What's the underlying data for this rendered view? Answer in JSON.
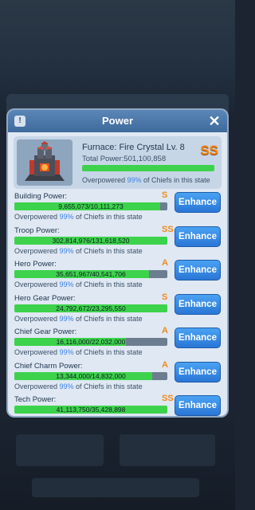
{
  "dialog": {
    "title": "Power",
    "info_label": "!",
    "close_label": "✕"
  },
  "furnace": {
    "name": "Furnace: Fire Crystal Lv. 8",
    "total_label": "Total Power:",
    "total_value": "501,100,858",
    "grade": "SS",
    "bar_fill_fraction": 1.0,
    "over_prefix": "Overpowered ",
    "over_percent": "99%",
    "over_suffix": " of Chiefs in this state"
  },
  "rows": [
    {
      "label": "Building Power:",
      "grade": "S",
      "value_text": "9,655,073/10,111,273",
      "fill_fraction": 0.955,
      "over_prefix": "Overpowered ",
      "over_percent": "99%",
      "over_suffix": " of Chiefs in this state",
      "button": "Enhance"
    },
    {
      "label": "Troop Power:",
      "grade": "SS",
      "value_text": "302,814,976/131,618,520",
      "fill_fraction": 1.0,
      "over_prefix": "Overpowered ",
      "over_percent": "99%",
      "over_suffix": " of Chiefs in this state",
      "button": "Enhance"
    },
    {
      "label": "Hero Power:",
      "grade": "A",
      "value_text": "35,651,967/40,541,706",
      "fill_fraction": 0.88,
      "over_prefix": "Overpowered ",
      "over_percent": "99%",
      "over_suffix": " of Chiefs in this state",
      "button": "Enhance"
    },
    {
      "label": "Hero Gear Power:",
      "grade": "S",
      "value_text": "24,792,672/23,295,550",
      "fill_fraction": 1.0,
      "over_prefix": "Overpowered ",
      "over_percent": "99%",
      "over_suffix": " of Chiefs in this state",
      "button": "Enhance"
    },
    {
      "label": "Chief Gear Power:",
      "grade": "A",
      "value_text": "16,116,000/22,032,000",
      "fill_fraction": 0.73,
      "over_prefix": "Overpowered ",
      "over_percent": "99%",
      "over_suffix": " of Chiefs in this state",
      "button": "Enhance"
    },
    {
      "label": "Chief Charm Power:",
      "grade": "A",
      "value_text": "13,344,000/14,832,000",
      "fill_fraction": 0.9,
      "over_prefix": "Overpowered ",
      "over_percent": "99%",
      "over_suffix": " of Chiefs in this state",
      "button": "Enhance"
    },
    {
      "label": "Tech Power:",
      "grade": "SS",
      "value_text": "41,113,750/35,428,898",
      "fill_fraction": 1.0,
      "over_prefix": "Overpowered ",
      "over_percent": "99%",
      "over_suffix": " of Chiefs in this state",
      "button": "Enhance"
    }
  ],
  "colors": {
    "accent_green": "#3dd24b",
    "grade_orange": "#f08a1c",
    "button_blue": "#2a76d6",
    "percent_blue": "#3b82e6"
  },
  "icons": {
    "info": "info-icon",
    "close": "close-icon",
    "furnace": "furnace-icon"
  }
}
